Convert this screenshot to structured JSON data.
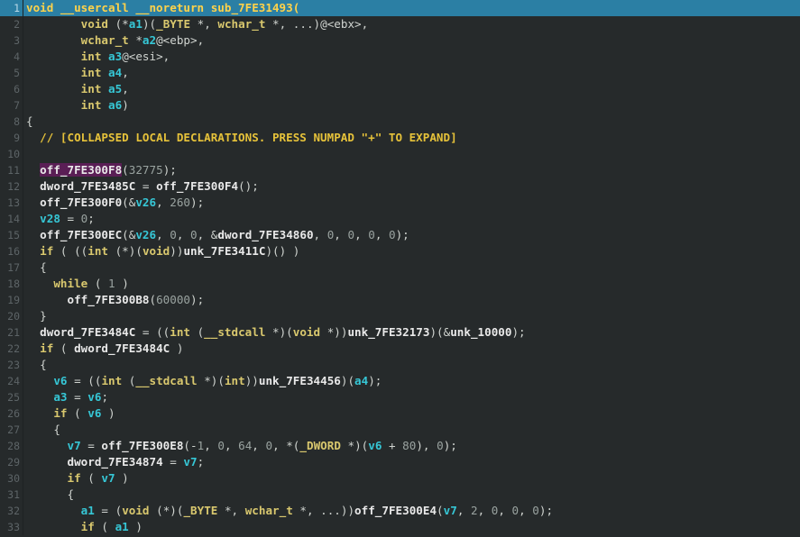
{
  "editor": {
    "lines": [
      {
        "n": "1",
        "segs": [
          [
            "hlw",
            "void __usercall __noreturn sub_7FE31493("
          ]
        ]
      },
      {
        "n": "2",
        "segs": [
          [
            "pun",
            "        "
          ],
          [
            "kw",
            "void"
          ],
          [
            "pun",
            " (*"
          ],
          [
            "var",
            "a1"
          ],
          [
            "pun",
            ")("
          ],
          [
            "kw",
            "_BYTE"
          ],
          [
            "pun",
            " *, "
          ],
          [
            "kw",
            "wchar_t"
          ],
          [
            "pun",
            " *, ...)@<ebx>,"
          ]
        ]
      },
      {
        "n": "3",
        "segs": [
          [
            "pun",
            "        "
          ],
          [
            "kw",
            "wchar_t"
          ],
          [
            "pun",
            " *"
          ],
          [
            "var",
            "a2"
          ],
          [
            "pun",
            "@<ebp>,"
          ]
        ]
      },
      {
        "n": "4",
        "segs": [
          [
            "pun",
            "        "
          ],
          [
            "kw",
            "int"
          ],
          [
            "pun",
            " "
          ],
          [
            "var",
            "a3"
          ],
          [
            "pun",
            "@<esi>,"
          ]
        ]
      },
      {
        "n": "5",
        "segs": [
          [
            "pun",
            "        "
          ],
          [
            "kw",
            "int"
          ],
          [
            "pun",
            " "
          ],
          [
            "var",
            "a4"
          ],
          [
            "pun",
            ","
          ]
        ]
      },
      {
        "n": "6",
        "segs": [
          [
            "pun",
            "        "
          ],
          [
            "kw",
            "int"
          ],
          [
            "pun",
            " "
          ],
          [
            "var",
            "a5"
          ],
          [
            "pun",
            ","
          ]
        ]
      },
      {
        "n": "7",
        "segs": [
          [
            "pun",
            "        "
          ],
          [
            "kw",
            "int"
          ],
          [
            "pun",
            " "
          ],
          [
            "var",
            "a6"
          ],
          [
            "pun",
            ")"
          ]
        ]
      },
      {
        "n": "8",
        "segs": [
          [
            "pun",
            "{"
          ]
        ]
      },
      {
        "n": "9",
        "segs": [
          [
            "pun",
            "  "
          ],
          [
            "cm",
            "// [COLLAPSED LOCAL DECLARATIONS. PRESS NUMPAD \"+\" TO EXPAND]"
          ]
        ]
      },
      {
        "n": "10",
        "segs": []
      },
      {
        "n": "11",
        "segs": [
          [
            "pun",
            "  "
          ],
          [
            "fn sel",
            "off_7FE300F8"
          ],
          [
            "pun",
            "("
          ],
          [
            "num",
            "32775"
          ],
          [
            "pun",
            ");"
          ]
        ]
      },
      {
        "n": "12",
        "segs": [
          [
            "pun",
            "  "
          ],
          [
            "fn",
            "dword_7FE3485C"
          ],
          [
            "pun",
            " = "
          ],
          [
            "fn",
            "off_7FE300F4"
          ],
          [
            "pun",
            "();"
          ]
        ]
      },
      {
        "n": "13",
        "segs": [
          [
            "pun",
            "  "
          ],
          [
            "fn",
            "off_7FE300F0"
          ],
          [
            "pun",
            "(&"
          ],
          [
            "var",
            "v26"
          ],
          [
            "pun",
            ", "
          ],
          [
            "num",
            "260"
          ],
          [
            "pun",
            ");"
          ]
        ]
      },
      {
        "n": "14",
        "segs": [
          [
            "pun",
            "  "
          ],
          [
            "var",
            "v28"
          ],
          [
            "pun",
            " = "
          ],
          [
            "num",
            "0"
          ],
          [
            "pun",
            ";"
          ]
        ]
      },
      {
        "n": "15",
        "segs": [
          [
            "pun",
            "  "
          ],
          [
            "fn",
            "off_7FE300EC"
          ],
          [
            "pun",
            "(&"
          ],
          [
            "var",
            "v26"
          ],
          [
            "pun",
            ", "
          ],
          [
            "num",
            "0"
          ],
          [
            "pun",
            ", "
          ],
          [
            "num",
            "0"
          ],
          [
            "pun",
            ", &"
          ],
          [
            "fn",
            "dword_7FE34860"
          ],
          [
            "pun",
            ", "
          ],
          [
            "num",
            "0"
          ],
          [
            "pun",
            ", "
          ],
          [
            "num",
            "0"
          ],
          [
            "pun",
            ", "
          ],
          [
            "num",
            "0"
          ],
          [
            "pun",
            ", "
          ],
          [
            "num",
            "0"
          ],
          [
            "pun",
            ");"
          ]
        ]
      },
      {
        "n": "16",
        "segs": [
          [
            "pun",
            "  "
          ],
          [
            "kw",
            "if"
          ],
          [
            "pun",
            " ( (("
          ],
          [
            "kw",
            "int"
          ],
          [
            "pun",
            " (*)("
          ],
          [
            "kw",
            "void"
          ],
          [
            "pun",
            "))"
          ],
          [
            "fn",
            "unk_7FE3411C"
          ],
          [
            "pun",
            ")() )"
          ]
        ]
      },
      {
        "n": "17",
        "segs": [
          [
            "pun",
            "  {"
          ]
        ]
      },
      {
        "n": "18",
        "segs": [
          [
            "pun",
            "    "
          ],
          [
            "kw",
            "while"
          ],
          [
            "pun",
            " ( "
          ],
          [
            "num",
            "1"
          ],
          [
            "pun",
            " )"
          ]
        ]
      },
      {
        "n": "19",
        "segs": [
          [
            "pun",
            "      "
          ],
          [
            "fn",
            "off_7FE300B8"
          ],
          [
            "pun",
            "("
          ],
          [
            "num",
            "60000"
          ],
          [
            "pun",
            ");"
          ]
        ]
      },
      {
        "n": "20",
        "segs": [
          [
            "pun",
            "  }"
          ]
        ]
      },
      {
        "n": "21",
        "segs": [
          [
            "pun",
            "  "
          ],
          [
            "fn",
            "dword_7FE3484C"
          ],
          [
            "pun",
            " = (("
          ],
          [
            "kw",
            "int"
          ],
          [
            "pun",
            " ("
          ],
          [
            "kw",
            "__stdcall"
          ],
          [
            "pun",
            " *)("
          ],
          [
            "kw",
            "void"
          ],
          [
            "pun",
            " *))"
          ],
          [
            "fn",
            "unk_7FE32173"
          ],
          [
            "pun",
            ")(&"
          ],
          [
            "fn",
            "unk_10000"
          ],
          [
            "pun",
            ");"
          ]
        ]
      },
      {
        "n": "22",
        "segs": [
          [
            "pun",
            "  "
          ],
          [
            "kw",
            "if"
          ],
          [
            "pun",
            " ( "
          ],
          [
            "fn",
            "dword_7FE3484C"
          ],
          [
            "pun",
            " )"
          ]
        ]
      },
      {
        "n": "23",
        "segs": [
          [
            "pun",
            "  {"
          ]
        ]
      },
      {
        "n": "24",
        "segs": [
          [
            "pun",
            "    "
          ],
          [
            "var",
            "v6"
          ],
          [
            "pun",
            " = (("
          ],
          [
            "kw",
            "int"
          ],
          [
            "pun",
            " ("
          ],
          [
            "kw",
            "__stdcall"
          ],
          [
            "pun",
            " *)("
          ],
          [
            "kw",
            "int"
          ],
          [
            "pun",
            "))"
          ],
          [
            "fn",
            "unk_7FE34456"
          ],
          [
            "pun",
            ")("
          ],
          [
            "var",
            "a4"
          ],
          [
            "pun",
            ");"
          ]
        ]
      },
      {
        "n": "25",
        "segs": [
          [
            "pun",
            "    "
          ],
          [
            "var",
            "a3"
          ],
          [
            "pun",
            " = "
          ],
          [
            "var",
            "v6"
          ],
          [
            "pun",
            ";"
          ]
        ]
      },
      {
        "n": "26",
        "segs": [
          [
            "pun",
            "    "
          ],
          [
            "kw",
            "if"
          ],
          [
            "pun",
            " ( "
          ],
          [
            "var",
            "v6"
          ],
          [
            "pun",
            " )"
          ]
        ]
      },
      {
        "n": "27",
        "segs": [
          [
            "pun",
            "    {"
          ]
        ]
      },
      {
        "n": "28",
        "segs": [
          [
            "pun",
            "      "
          ],
          [
            "var",
            "v7"
          ],
          [
            "pun",
            " = "
          ],
          [
            "fn",
            "off_7FE300E8"
          ],
          [
            "pun",
            "(-"
          ],
          [
            "num",
            "1"
          ],
          [
            "pun",
            ", "
          ],
          [
            "num",
            "0"
          ],
          [
            "pun",
            ", "
          ],
          [
            "num",
            "64"
          ],
          [
            "pun",
            ", "
          ],
          [
            "num",
            "0"
          ],
          [
            "pun",
            ", *("
          ],
          [
            "kw",
            "_DWORD"
          ],
          [
            "pun",
            " *)("
          ],
          [
            "var",
            "v6"
          ],
          [
            "pun",
            " + "
          ],
          [
            "num",
            "80"
          ],
          [
            "pun",
            "), "
          ],
          [
            "num",
            "0"
          ],
          [
            "pun",
            ");"
          ]
        ]
      },
      {
        "n": "29",
        "segs": [
          [
            "pun",
            "      "
          ],
          [
            "fn",
            "dword_7FE34874"
          ],
          [
            "pun",
            " = "
          ],
          [
            "var",
            "v7"
          ],
          [
            "pun",
            ";"
          ]
        ]
      },
      {
        "n": "30",
        "segs": [
          [
            "pun",
            "      "
          ],
          [
            "kw",
            "if"
          ],
          [
            "pun",
            " ( "
          ],
          [
            "var",
            "v7"
          ],
          [
            "pun",
            " )"
          ]
        ]
      },
      {
        "n": "31",
        "segs": [
          [
            "pun",
            "      {"
          ]
        ]
      },
      {
        "n": "32",
        "segs": [
          [
            "pun",
            "        "
          ],
          [
            "var",
            "a1"
          ],
          [
            "pun",
            " = ("
          ],
          [
            "kw",
            "void"
          ],
          [
            "pun",
            " (*)("
          ],
          [
            "kw",
            "_BYTE"
          ],
          [
            "pun",
            " *, "
          ],
          [
            "kw",
            "wchar_t"
          ],
          [
            "pun",
            " *, ...))"
          ],
          [
            "fn",
            "off_7FE300E4"
          ],
          [
            "pun",
            "("
          ],
          [
            "var",
            "v7"
          ],
          [
            "pun",
            ", "
          ],
          [
            "num",
            "2"
          ],
          [
            "pun",
            ", "
          ],
          [
            "num",
            "0"
          ],
          [
            "pun",
            ", "
          ],
          [
            "num",
            "0"
          ],
          [
            "pun",
            ", "
          ],
          [
            "num",
            "0"
          ],
          [
            "pun",
            ");"
          ]
        ]
      },
      {
        "n": "33",
        "segs": [
          [
            "pun",
            "        "
          ],
          [
            "kw",
            "if"
          ],
          [
            "pun",
            " ( "
          ],
          [
            "var",
            "a1"
          ],
          [
            "pun",
            " )"
          ]
        ]
      }
    ]
  }
}
